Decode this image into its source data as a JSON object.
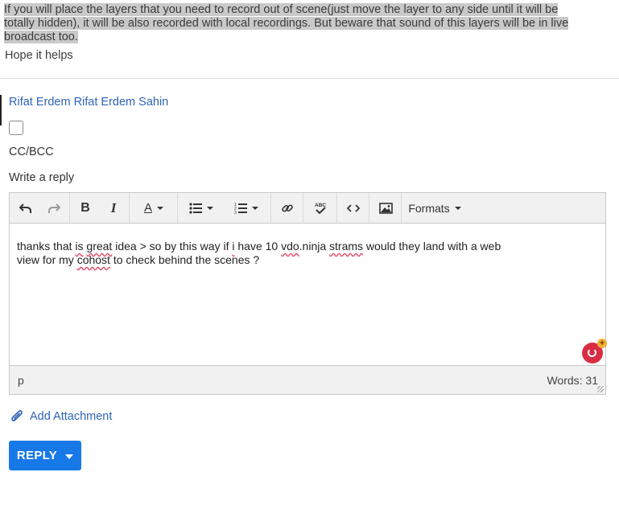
{
  "quote": {
    "line1": "If you will place the layers that you need to record out of scene(just move the layer to any side until it will be",
    "line2": "totally hidden), it will be also recorded with local recordings. But beware that sound of this layers will be in live",
    "line3": "broadcast too.",
    "hope": "Hope it helps"
  },
  "reply_form": {
    "author": "Rifat Erdem Rifat Erdem Sahin",
    "cc_bcc_label": "CC/BCC",
    "write_label": "Write a reply"
  },
  "toolbar": {
    "undo_icon": "undo-icon",
    "redo_icon": "redo-icon",
    "bold_label": "B",
    "italic_label": "I",
    "font_color_label": "A",
    "bullet_list_icon": "bullet-list-icon",
    "numbered_list_icon": "numbered-list-icon",
    "link_icon": "link-icon",
    "spellcheck_icon": "spellcheck-icon",
    "code_icon": "code-icon",
    "image_icon": "image-icon",
    "formats_label": "Formats"
  },
  "editor": {
    "seg1": "thanks that ",
    "err1": "is",
    "seg2": " ",
    "err2": "great",
    "seg3": " idea > so by this way if ",
    "err3": "i",
    "seg4": " have 10 ",
    "err4": "vdo",
    "seg5": ".ninja ",
    "err5": "strams",
    "seg6": " would they land with a web",
    "line2_a": "view for my ",
    "err6": "cohost",
    "line2_b": " to check behind the scenes ?",
    "status_path": "p",
    "word_count": "Words: 31"
  },
  "attachment": {
    "label": "Add Attachment",
    "icon": "paperclip-icon"
  },
  "reply_button": {
    "label": "REPLY"
  },
  "colors": {
    "accent": "#1779e8",
    "link": "#2f63b5",
    "spell_error": "#e04b6a"
  }
}
